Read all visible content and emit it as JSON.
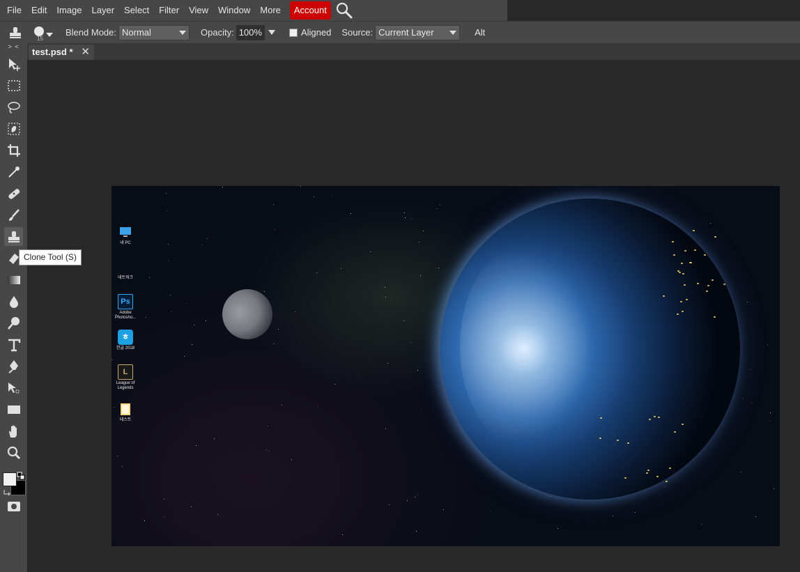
{
  "menubar": {
    "items": [
      "File",
      "Edit",
      "Image",
      "Layer",
      "Select",
      "Filter",
      "View",
      "Window",
      "More"
    ],
    "account_label": "Account",
    "search_icon": "search-icon"
  },
  "options": {
    "brush_size": "15",
    "blend_mode_label": "Blend Mode:",
    "blend_mode_value": "Normal",
    "opacity_label": "Opacity:",
    "opacity_value": "100%",
    "aligned_label": "Aligned",
    "aligned_checked": false,
    "source_label": "Source:",
    "source_value": "Current Layer",
    "alt_label": "Alt"
  },
  "toolbox": {
    "collapse_label": "> <",
    "active_tool": "Clone Tool",
    "tools": [
      "move",
      "marquee",
      "lasso",
      "quick-selection",
      "crop",
      "eyedropper",
      "healing",
      "brush",
      "clone-stamp",
      "eraser",
      "gradient",
      "blur",
      "dodge",
      "type",
      "pen",
      "path-selection",
      "shape",
      "hand",
      "zoom"
    ],
    "foreground_color": "#f2f2f2",
    "background_color": "#000000"
  },
  "tooltip": {
    "text": "Clone Tool (S)"
  },
  "document_tab": {
    "title": "test.psd *"
  },
  "desktop_icons": [
    {
      "label": "내 PC",
      "icon": "computer-icon"
    },
    {
      "label": "네트워크",
      "icon": "network-icon"
    },
    {
      "label": "Adobe Photosho...",
      "icon": "photoshop-icon"
    },
    {
      "label": "한글 2018",
      "icon": "hangul-icon"
    },
    {
      "label": "League of Legends",
      "icon": "league-icon"
    },
    {
      "label": "테스트",
      "icon": "folder-icon"
    }
  ],
  "colors": {
    "accent": "#cc0000",
    "panel": "#474747",
    "background": "#282828"
  }
}
